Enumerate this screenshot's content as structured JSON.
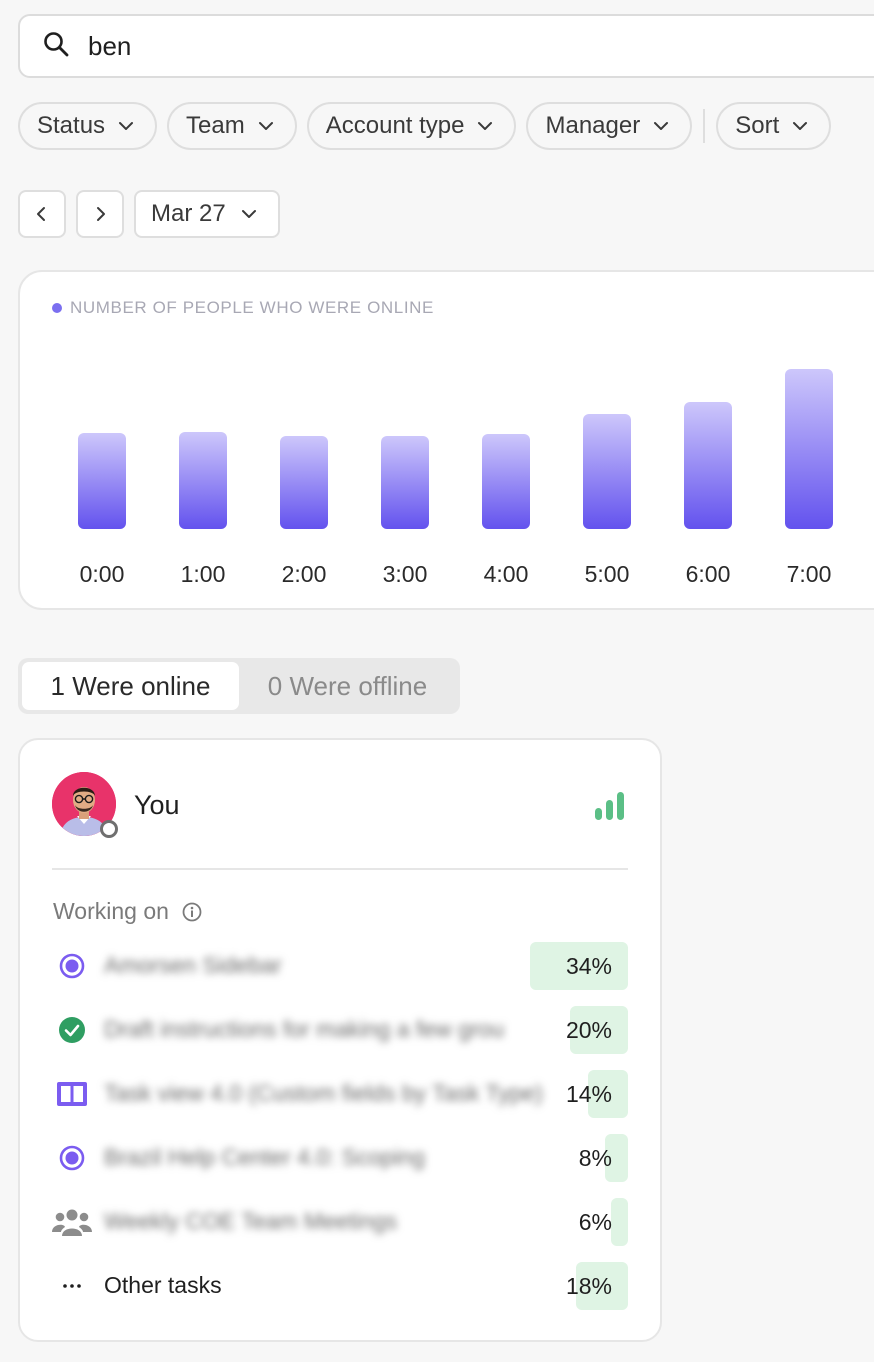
{
  "search": {
    "value": "ben",
    "icon": "search-icon"
  },
  "filters": [
    {
      "label": "Status"
    },
    {
      "label": "Team"
    },
    {
      "label": "Account type"
    },
    {
      "label": "Manager"
    }
  ],
  "sort": {
    "label": "Sort"
  },
  "date_nav": {
    "date": "Mar 27"
  },
  "chart_data": {
    "type": "bar",
    "title": "NUMBER OF PEOPLE WHO WERE ONLINE",
    "categories": [
      "0:00",
      "1:00",
      "2:00",
      "3:00",
      "4:00",
      "5:00",
      "6:00",
      "7:00"
    ],
    "values": [
      96,
      97,
      93,
      93,
      95,
      115,
      127,
      160
    ],
    "ylim": [
      0,
      170
    ],
    "grid": false,
    "colors": {
      "bar_top": "#cdc7fb",
      "bar_bottom": "#6352ee",
      "title_dot": "#7b6ff0"
    }
  },
  "tabs": {
    "online": "1 Were online",
    "offline": "0 Were offline",
    "active": "online"
  },
  "person": {
    "name": "You",
    "avatar_bg": "#e8336a",
    "signal_color": "#5bbf86",
    "working_on_label": "Working on",
    "tasks": [
      {
        "icon": "status-circle-icon",
        "label": "Amorsen Sidebar",
        "percent": 34,
        "percent_label": "34%",
        "blurred": true
      },
      {
        "icon": "check-circle-icon",
        "label": "Draft instructions for making a few grou",
        "percent": 20,
        "percent_label": "20%",
        "blurred": true
      },
      {
        "icon": "board-view-icon",
        "label": "Task view 4.0 (Custom fields by Task Type)",
        "percent": 14,
        "percent_label": "14%",
        "blurred": true
      },
      {
        "icon": "status-circle-icon",
        "label": "Brazil Help Center 4.0: Scoping",
        "percent": 8,
        "percent_label": "8%",
        "blurred": true
      },
      {
        "icon": "people-icon",
        "label": "Weekly COE Team Meetings",
        "percent": 6,
        "percent_label": "6%",
        "blurred": true
      },
      {
        "icon": "more-dots-icon",
        "label": "Other tasks",
        "percent": 18,
        "percent_label": "18%",
        "blurred": false
      }
    ]
  }
}
